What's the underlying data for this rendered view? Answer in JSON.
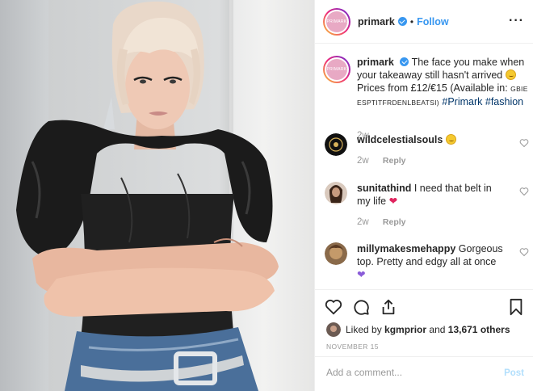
{
  "photo": {
    "alt_icon": "post-photo"
  },
  "header": {
    "username": "primark",
    "avatar_text": "PRIMARK",
    "dot": "•",
    "follow_label": "Follow",
    "more_icon": "more-horizontal-icon",
    "more_label": "···"
  },
  "caption": {
    "username": "primark",
    "text": "The face you make when your takeaway still hasn't arrived",
    "prices": "Prices from £12/€15 (Available in:",
    "countries": "GBIE ESPTITFRDENLBEATSI)",
    "tag1": "#Primark",
    "tag2": "#fashion",
    "time": "2w"
  },
  "comments": [
    {
      "username": "wildcelestialsouls",
      "text": "",
      "emoji": "laughing-emoji",
      "time": "2w",
      "reply_label": "Reply"
    },
    {
      "username": "sunitathind",
      "text": "I need that belt in my life",
      "emoji": "red-heart-emoji",
      "time": "2w",
      "reply_label": "Reply"
    },
    {
      "username": "millymakesmehappy",
      "text": "Gorgeous top. Pretty and edgy all at once",
      "emoji": "purple-heart-emoji",
      "time": "",
      "reply_label": ""
    }
  ],
  "likes": {
    "prefix": "Liked by",
    "user": "kgmprior",
    "and": "and",
    "count": "13,671 others"
  },
  "date": "NOVEMBER 15",
  "add_comment": {
    "placeholder": "Add a comment...",
    "post_label": "Post"
  },
  "colors": {
    "link": "#3897f0",
    "hashtag": "#003569",
    "muted": "#999999",
    "post_disabled": "#b2dffc"
  }
}
